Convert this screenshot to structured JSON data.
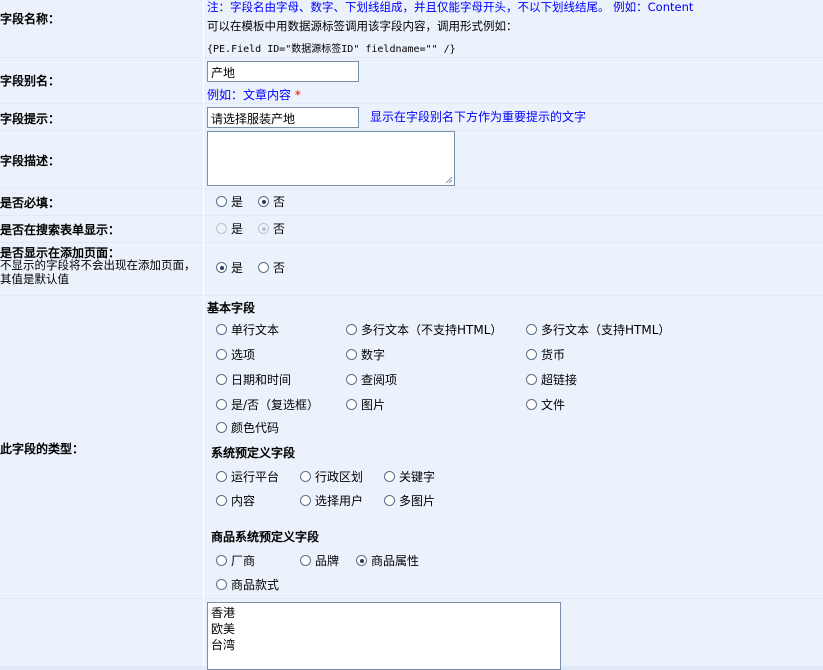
{
  "field_name": {
    "label": "字段名称：",
    "note": "注：字段名由字母、数字、下划线组成，并且仅能字母开头，不以下划线结尾。 例如：Content",
    "hint": "可以在模板中用数据源标签调用该字段内容，调用形式例如：",
    "code": "{PE.Field ID=\"数据源标签ID\" fieldname=\"\" /}"
  },
  "field_alias": {
    "label": "字段别名：",
    "value": "产地",
    "example": "例如：文章内容",
    "required_mark": "*"
  },
  "field_tip": {
    "label": "字段提示：",
    "value": "请选择服装产地",
    "help": "显示在字段别名下方作为重要提示的文字"
  },
  "field_desc": {
    "label": "字段描述：",
    "value": ""
  },
  "required": {
    "label": "是否必填：",
    "options": [
      "是",
      "否"
    ],
    "selected": "否"
  },
  "search_show": {
    "label": "是否在搜索表单显示：",
    "options": [
      "是",
      "否"
    ],
    "selected": "否",
    "disabled": true
  },
  "add_page_show": {
    "label": "是否显示在添加页面：",
    "note": "不显示的字段将不会出现在添加页面，其值是默认值",
    "options": [
      "是",
      "否"
    ],
    "selected": "是"
  },
  "field_type": {
    "label": "此字段的类型：",
    "basic_title": "基本字段",
    "basic": [
      "单行文本",
      "多行文本（不支持HTML）",
      "多行文本（支持HTML）",
      "选项",
      "数字",
      "货币",
      "日期和时间",
      "查阅项",
      "超链接",
      "是/否（复选框）",
      "图片",
      "文件",
      "颜色代码"
    ],
    "system_title": "系统预定义字段",
    "system": [
      "运行平台",
      "行政区划",
      "关键字",
      "内容",
      "选择用户",
      "多图片"
    ],
    "product_title": "商品系统预定义字段",
    "product": [
      "厂商",
      "品牌",
      "商品属性",
      "商品款式"
    ],
    "selected": "商品属性"
  },
  "options_list": [
    "香港",
    "欧美",
    "台湾"
  ]
}
